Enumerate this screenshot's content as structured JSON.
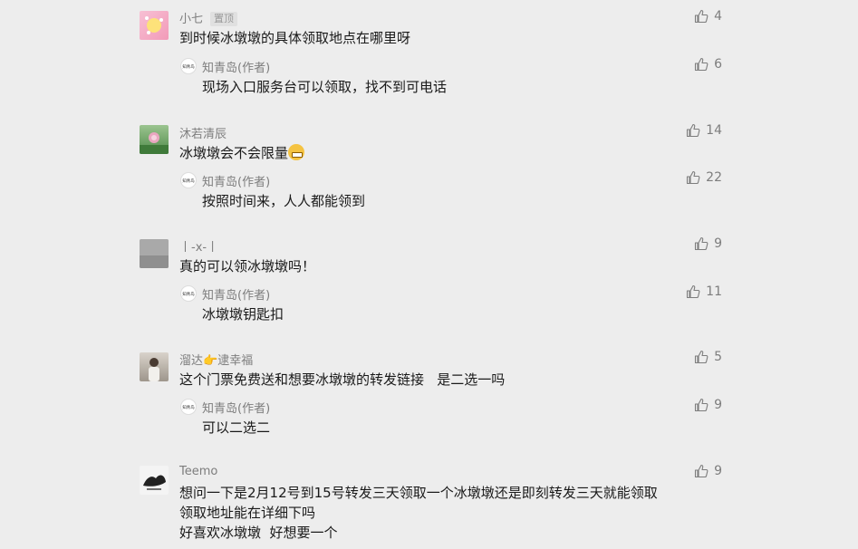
{
  "comments": [
    {
      "user": "小七",
      "pinned_label": "置顶",
      "text": "到时候冰墩墩的具体领取地点在哪里呀",
      "likes": "4",
      "reply": {
        "author": "知青岛(作者)",
        "text": "现场入口服务台可以领取，找不到可电话",
        "likes": "6"
      }
    },
    {
      "user": "沐若清辰",
      "text": "冰墩墩会不会限量",
      "likes": "14",
      "reply": {
        "author": "知青岛(作者)",
        "text": "按照时间来，人人都能领到",
        "likes": "22"
      }
    },
    {
      "user": "丨-x-丨",
      "text": "真的可以领冰墩墩吗！",
      "likes": "9",
      "reply": {
        "author": "知青岛(作者)",
        "text": "冰墩墩钥匙扣",
        "likes": "11"
      }
    },
    {
      "user_part1": "溜达",
      "user_part2": "逮幸福",
      "text": "这个门票免费送和想要冰墩墩的转发链接   是二选一吗",
      "likes": "5",
      "reply": {
        "author": "知青岛(作者)",
        "text": "可以二选二",
        "likes": "9"
      }
    },
    {
      "user": "Teemo",
      "text_lines": [
        "想问一下是2月12号到15号转发三天领取一个冰墩墩还是即刻转发三天就能领取",
        "领取地址能在详细下吗",
        "好喜欢冰墩墩  好想要一个"
      ],
      "likes": "9"
    }
  ],
  "icons": {
    "like": "thumbs-up-icon",
    "author_avatar": "zhiqingdao-logo"
  },
  "colors": {
    "background": "#ededed",
    "text": "#191919",
    "meta": "#7d7d7d"
  }
}
